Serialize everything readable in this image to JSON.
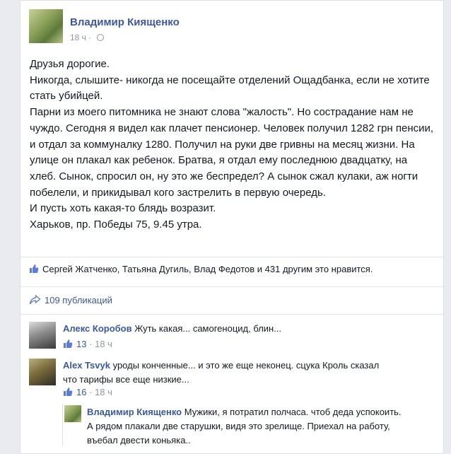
{
  "post": {
    "author": "Владимир Киященко",
    "time": "18 ч",
    "dot": "·",
    "lines": [
      "Друзья дорогие.",
      "Никогда, слышите- никогда не посещайте отделений Ощадбанка, если не хотите стать убийцей.",
      "Парни из моего питомника не знают слова \"жалость\". Но сострадание нам не чуждо. Сегодня я видел как плачет пенсионер. Человек получил 1282 грн пенсии, и отдал за коммуналку 1280. Получил на руки две гривны на месяц жизни. На улице он плакал как ребенок. Братва, я отдал ему последнюю двадцатку, на хлеб. Сынок, спросил он, ну это же беспредел? А сынок сжал кулаки, аж ногти побелели, и прикидывал кого застрелить в первую очередь.",
      "И пусть хоть какая-то блядь возразит.",
      "Харьков, пр. Победы 75, 9.45 утра."
    ],
    "likes": "Сергей Жатченко, Татьяна Дугиль, Влад Федотов и 431 другим это нравится.",
    "shares": "109 публикаций"
  },
  "comments": [
    {
      "name": "Алекс Коробов",
      "text": "Жуть какая... самогеноцид, блин...",
      "likes": "13",
      "time": "18 ч",
      "dot": "·"
    },
    {
      "name": "Alex Tsvyk",
      "text": "уроды конченные... и это же еще неконец. сцука Кроль сказал что тарифы все еще низкие...",
      "likes": "16",
      "time": "18 ч",
      "dot": "·"
    },
    {
      "name": "Владимир Киященко",
      "text": "Мужики, я потратил полчаса. чтоб деда успокоить. А рядом плакали две старушки, видя это зрелище. Приехал на работу, въебал двести коньяка.."
    }
  ],
  "colors": {
    "link": "#3b5998",
    "meta": "#9197a3",
    "text": "#141823"
  },
  "icons": [
    "globe-icon",
    "thumbs-up-icon",
    "share-arrow-icon"
  ]
}
